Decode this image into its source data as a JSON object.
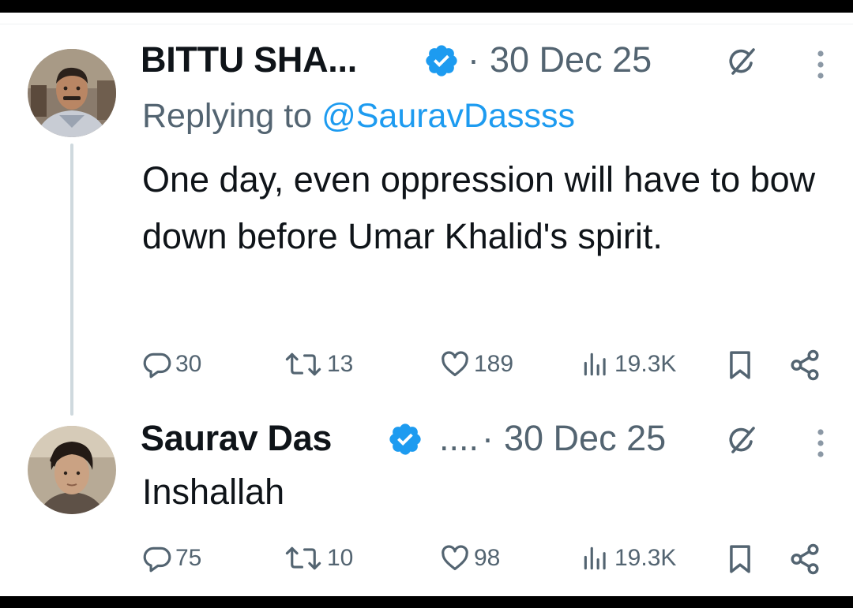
{
  "tweets": [
    {
      "author_name": "BITTU SHA...",
      "verified": true,
      "separator": "·",
      "date": "30 Dec 25",
      "replying_prefix": "Replying to ",
      "replying_handle": "@SauravDassss",
      "text": "One day, even oppression will have to bow down before Umar Khalid's spirit.",
      "replies": "30",
      "reposts": "13",
      "likes": "189",
      "views": "19.3K"
    },
    {
      "author_name": "Saurav Das",
      "verified": true,
      "ellipsis": "....",
      "separator": "·",
      "date": "30 Dec 25",
      "text": "Inshallah",
      "replies": "75",
      "reposts": "10",
      "likes": "98",
      "views": "19.3K"
    }
  ],
  "icons": [
    "verified-badge-icon",
    "grok-icon",
    "more-icon",
    "reply-icon",
    "repost-icon",
    "like-icon",
    "views-icon",
    "bookmark-icon",
    "share-icon"
  ],
  "colors": {
    "accent": "#1d9bf0",
    "muted": "#536471",
    "text": "#0f1419",
    "thread_line": "#cfd9de"
  }
}
